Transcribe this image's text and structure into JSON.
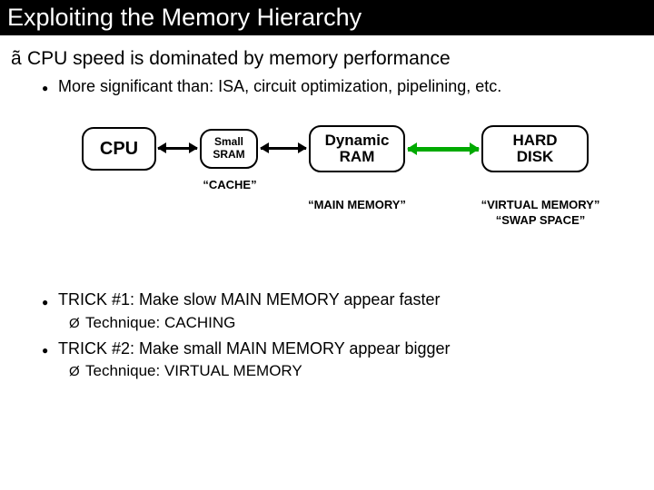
{
  "title": "Exploiting the Memory Hierarchy",
  "bullet1": {
    "glyph": "ã",
    "text": "CPU speed is dominated by memory performance"
  },
  "sub1": "More significant than: ISA, circuit optimization, pipelining, etc.",
  "diagram": {
    "cpu": "CPU",
    "sram_l1": "Small",
    "sram_l2": "SRAM",
    "dram_l1": "Dynamic",
    "dram_l2": "RAM",
    "disk_l1": "HARD",
    "disk_l2": "DISK",
    "cap_cache": "“CACHE”",
    "cap_main": "“MAIN MEMORY”",
    "cap_vm_l1": "“VIRTUAL MEMORY”",
    "cap_vm_l2": "“SWAP SPACE”"
  },
  "trick1": "TRICK #1:  Make slow MAIN MEMORY appear faster",
  "trick1_tech": "Technique:  CACHING",
  "trick2": "TRICK #2:  Make small MAIN MEMORY appear bigger",
  "trick2_tech": "Technique:  VIRTUAL MEMORY"
}
